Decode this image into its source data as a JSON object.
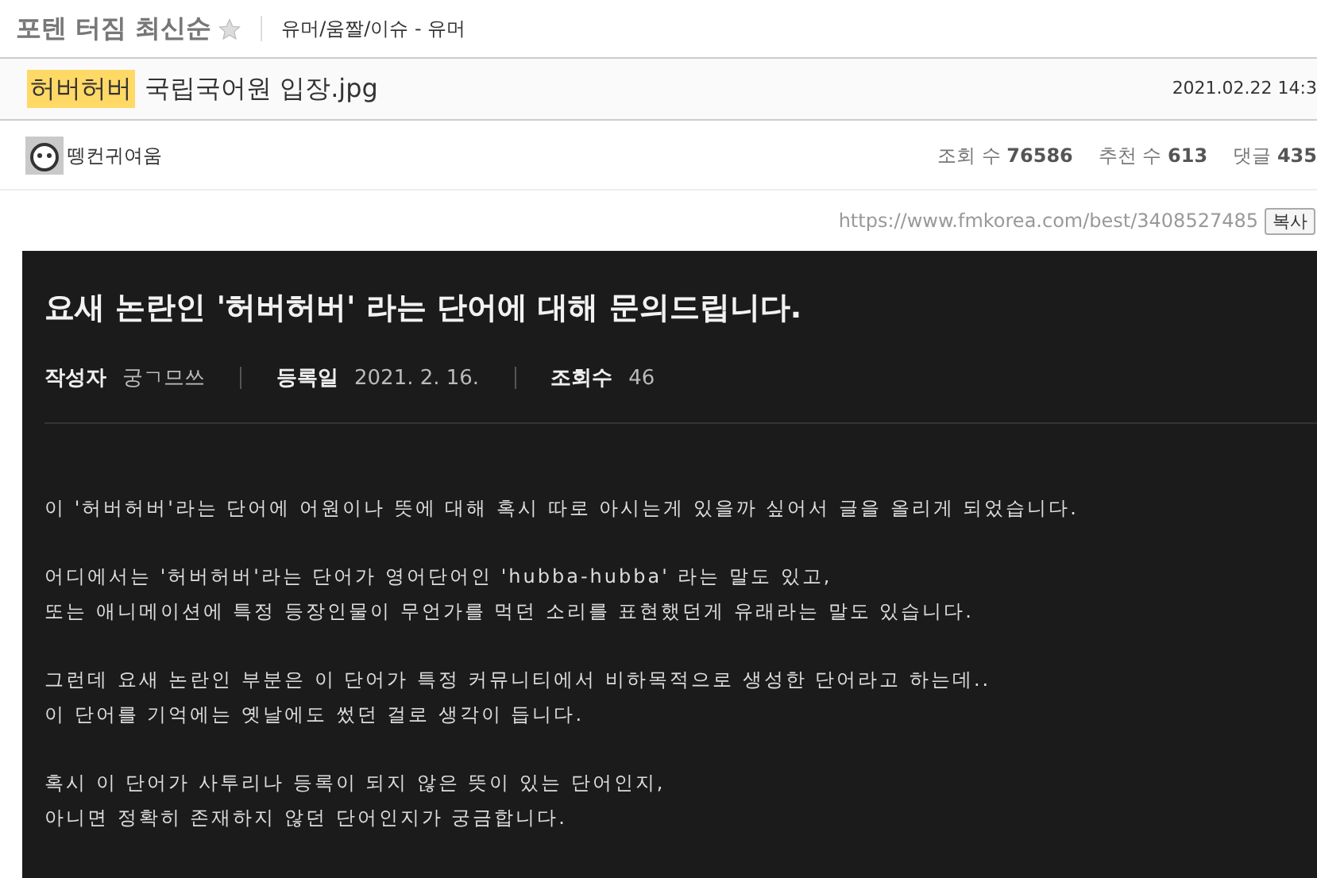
{
  "board": {
    "name": "포텐 터짐 최신순",
    "favorite": false,
    "category": "유머/움짤/이슈 - 유머"
  },
  "post": {
    "tag": "허버허버",
    "title": "국립국어원 입장.jpg",
    "date": "2021.02.22 14:3"
  },
  "author": {
    "name": "뗑컨귀여움"
  },
  "stats": [
    {
      "label": "조회 수",
      "value": "76586"
    },
    {
      "label": "추천 수",
      "value": "613"
    },
    {
      "label": "댓글",
      "value": "435"
    }
  ],
  "link": {
    "url": "https://www.fmkorea.com/best/3408527485",
    "button": "복사"
  },
  "image": {
    "heading": "요새 논란인 '허버허버' 라는 단어에 대해 문의드립니다.",
    "meta": [
      {
        "label": "작성자",
        "value": "궁ㄱ므쓰"
      },
      {
        "label": "등록일",
        "value": "2021. 2. 16."
      },
      {
        "label": "조회수",
        "value": "46"
      }
    ],
    "paragraphs": [
      [
        "이 '허버허버'라는 단어에 어원이나 뜻에 대해 혹시 따로 아시는게 있을까 싶어서 글을 올리게 되었습니다."
      ],
      [
        "어디에서는 '허버허버'라는 단어가 영어단어인 'hubba-hubba' 라는 말도 있고,",
        "또는 애니메이션에 특정 등장인물이 무언가를 먹던 소리를 표현했던게 유래라는 말도 있습니다."
      ],
      [
        "그런데 요새 논란인 부분은 이 단어가 특정 커뮤니티에서 비하목적으로 생성한 단어라고 하는데..",
        "이 단어를 기억에는 옛날에도 썼던 걸로 생각이 듭니다."
      ],
      [
        "혹시 이 단어가 사투리나 등록이 되지 않은 뜻이 있는 단어인지,",
        "아니면 정확히 존재하지 않던 단어인지가 궁금합니다."
      ]
    ]
  }
}
